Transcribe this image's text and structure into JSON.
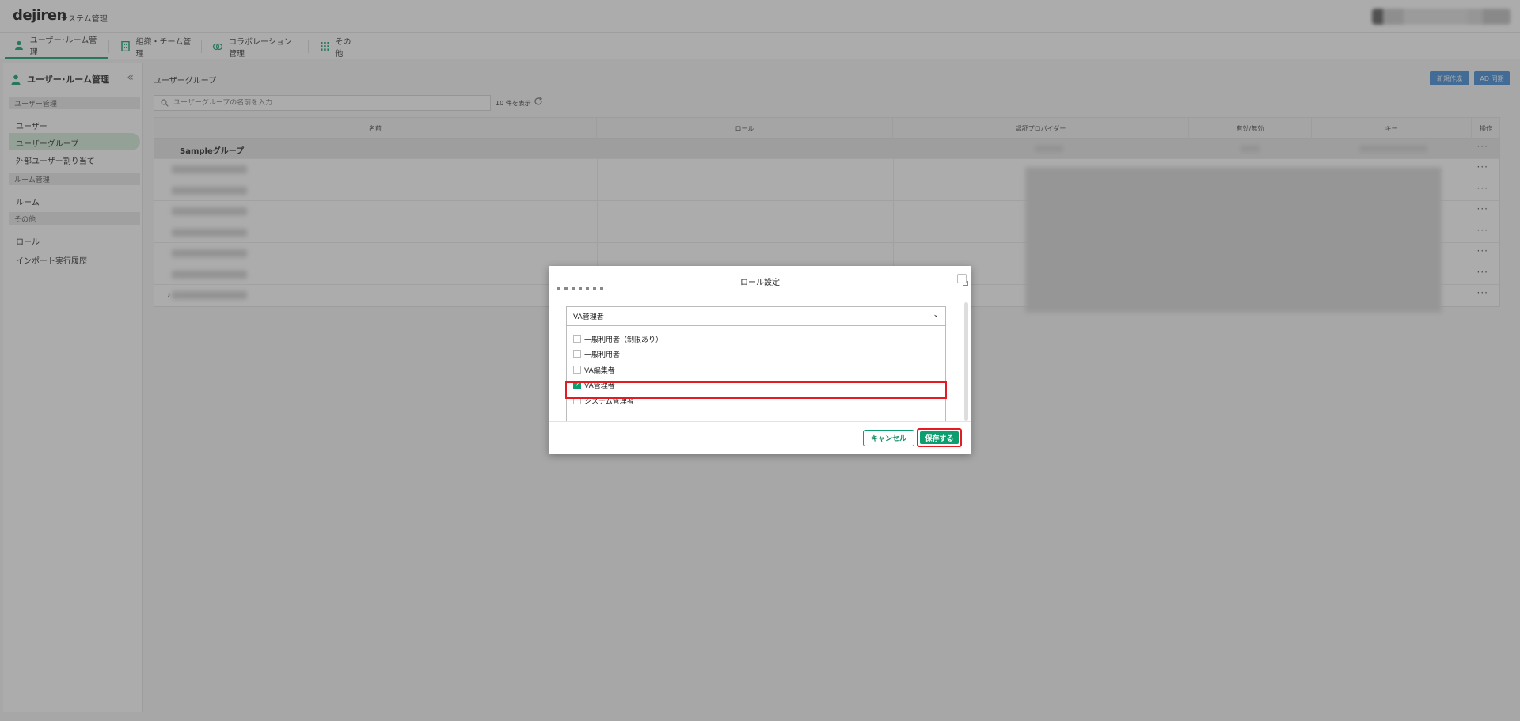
{
  "header": {
    "logo": "dejiren",
    "subtitle": "システム管理"
  },
  "tabs": [
    {
      "label": "ユーザー･ルーム管理"
    },
    {
      "label": "組織・チーム管理"
    },
    {
      "label": "コラボレーション管理"
    },
    {
      "label": "その他"
    }
  ],
  "sidebar": {
    "title": "ユーザー･ルーム管理",
    "sections": [
      {
        "label": "ユーザー管理"
      },
      {
        "label": "ルーム管理"
      },
      {
        "label": "その他"
      }
    ],
    "items": [
      {
        "label": "ユーザー"
      },
      {
        "label": "ユーザーグループ"
      },
      {
        "label": "外部ユーザー割り当て"
      },
      {
        "label": "ルーム"
      },
      {
        "label": "ロール"
      },
      {
        "label": "インポート実行履歴"
      }
    ]
  },
  "main": {
    "title": "ユーザーグループ",
    "new_button": "新規作成",
    "ad_button": "AD 同期",
    "search_placeholder": "ユーザーグループの名前を入力",
    "count_label": "10 件を表示",
    "columns": [
      "名前",
      "ロール",
      "認証プロバイダー",
      "有効/無効",
      "キー",
      "操作"
    ],
    "group_row": "Sampleグループ",
    "ops_label": "···"
  },
  "modal": {
    "title": "ロール設定",
    "selected_value": "VA管理者",
    "options": [
      {
        "label": "一般利用者（制限あり）",
        "checked": false
      },
      {
        "label": "一般利用者",
        "checked": false
      },
      {
        "label": "VA編集者",
        "checked": false
      },
      {
        "label": "VA管理者",
        "checked": true
      },
      {
        "label": "システム管理者",
        "checked": false
      }
    ],
    "cancel_label": "キャンセル",
    "save_label": "保存する"
  },
  "colors": {
    "accent": "#0b9e6e",
    "highlight": "#e51b24",
    "button_blue": "#3f8bd6"
  }
}
